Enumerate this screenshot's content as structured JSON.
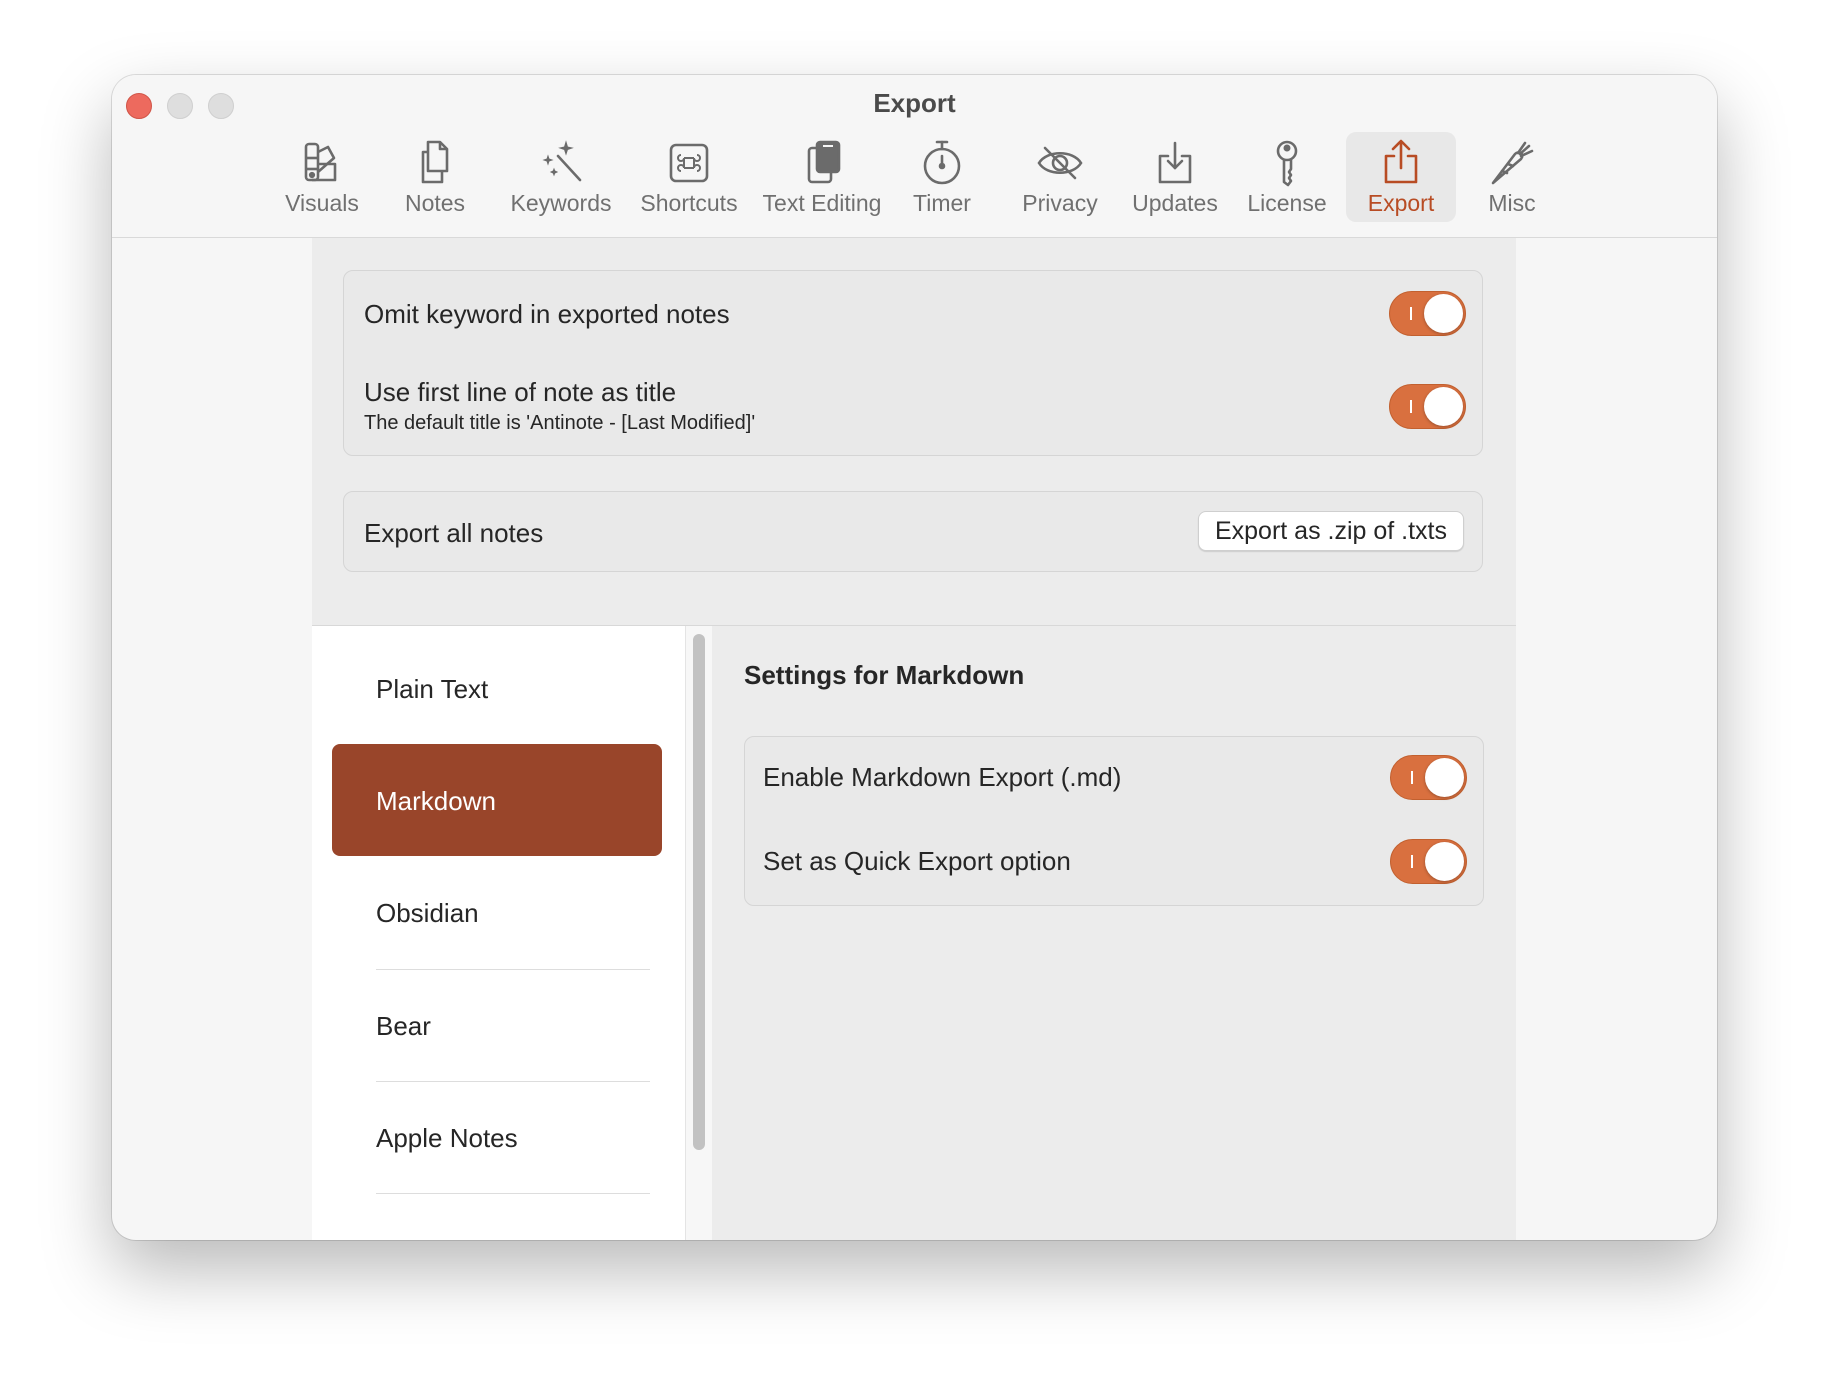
{
  "window": {
    "title": "Export"
  },
  "toolbar": {
    "items": [
      {
        "label": "Visuals",
        "icon": "swatchbook-icon"
      },
      {
        "label": "Notes",
        "icon": "documents-icon"
      },
      {
        "label": "Keywords",
        "icon": "magic-wand-icon"
      },
      {
        "label": "Shortcuts",
        "icon": "command-key-icon"
      },
      {
        "label": "Text Editing",
        "icon": "clipboard-icon"
      },
      {
        "label": "Timer",
        "icon": "stopwatch-icon"
      },
      {
        "label": "Privacy",
        "icon": "eye-slash-icon"
      },
      {
        "label": "Updates",
        "icon": "download-tray-icon"
      },
      {
        "label": "License",
        "icon": "key-icon"
      },
      {
        "label": "Export",
        "icon": "share-icon"
      },
      {
        "label": "Misc",
        "icon": "carrot-icon"
      }
    ],
    "active_index": 9
  },
  "general": {
    "omit_keyword": {
      "label": "Omit keyword in exported notes",
      "on": true
    },
    "first_line_title": {
      "label": "Use first line of note as title",
      "description": "The default title is 'Antinote - [Last Modified]'",
      "on": true
    }
  },
  "export_all": {
    "label": "Export all notes",
    "button_label": "Export as .zip of .txts"
  },
  "formats": {
    "items": [
      "Plain Text",
      "Markdown",
      "Obsidian",
      "Bear",
      "Apple Notes"
    ],
    "selected": "Markdown"
  },
  "detail": {
    "title": "Settings for Markdown",
    "enable_export": {
      "label": "Enable Markdown Export (.md)",
      "on": true
    },
    "quick_export": {
      "label": "Set as Quick Export option",
      "on": true
    }
  },
  "colors": {
    "accent": "#d9703f",
    "selection": "#99452a",
    "active_tab_text": "#b84c24",
    "close_button": "#ed6a5e"
  }
}
